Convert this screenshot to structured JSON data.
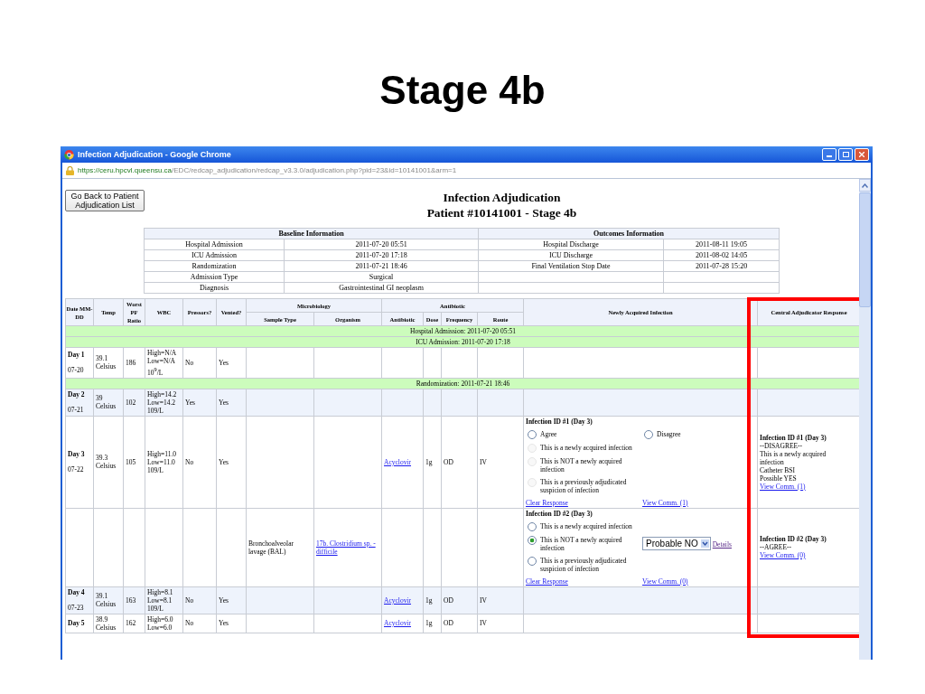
{
  "slide_title": "Stage 4b",
  "window": {
    "title": "Infection Adjudication - Google Chrome",
    "url_host": "https://ceru.hpcvl.queensu.ca",
    "url_path": "/EDC/redcap_adjudication/redcap_v3.3.0/adjudication.php?pid=23&id=10141001&arm=1"
  },
  "back_button": "Go Back to Patient Adjudication List",
  "heading": [
    "Infection Adjudication",
    "Patient #10141001 - Stage 4b"
  ],
  "info_table": {
    "baseline_title": "Baseline Information",
    "outcomes_title": "Outcomes Information",
    "baseline": [
      {
        "label": "Hospital Admission",
        "value": "2011-07-20 05:51"
      },
      {
        "label": "ICU Admission",
        "value": "2011-07-20 17:18"
      },
      {
        "label": "Randomization",
        "value": "2011-07-21 18:46"
      },
      {
        "label": "Admission Type",
        "value": "Surgical"
      },
      {
        "label": "Diagnosis",
        "value": "Gastrointestinal GI neoplasm"
      }
    ],
    "outcomes": [
      {
        "label": "Hospital Discharge",
        "value": "2011-08-11 19:05"
      },
      {
        "label": "ICU Discharge",
        "value": "2011-08-02 14:05"
      },
      {
        "label": "Final Ventilation Stop Date",
        "value": "2011-07-28 15:20"
      }
    ]
  },
  "main_table": {
    "columns": [
      {
        "label": "Date MM-DD"
      },
      {
        "label": "Temp"
      },
      {
        "label": "Worst PF Ratio"
      },
      {
        "label": "WBC"
      },
      {
        "label": "Pressors?"
      },
      {
        "label": "Vented?"
      },
      {
        "label": "Microbiology",
        "children": [
          "Sample Type",
          "Organism"
        ]
      },
      {
        "label": "Antibiotic",
        "children": [
          "Antibiotic",
          "Dose",
          "Frequency",
          "Route"
        ]
      },
      {
        "label": "Newly Acquired Infection"
      },
      {
        "label": "Central Adjudicator Response",
        "highlighted": true
      }
    ],
    "rows": [
      {
        "kind": "band",
        "text": "Hospital Admission: 2011-07-20 05:51"
      },
      {
        "kind": "band",
        "text": "ICU Admission: 2011-07-20 17:18"
      },
      {
        "kind": "day",
        "day": "Day 1",
        "date": "07-20",
        "temp": [
          "39.1",
          "Celsius"
        ],
        "pf": "186",
        "wbc": [
          "High=N/A",
          "Low=N/A",
          "10$^{9}$/L"
        ],
        "pressors": "No",
        "vented": "Yes"
      },
      {
        "kind": "band",
        "text": "Randomization: 2011-07-21 18:46"
      },
      {
        "kind": "day",
        "day": "Day 2",
        "date": "07-21",
        "temp": [
          "39",
          "Celsius"
        ],
        "pf": "102",
        "wbc": [
          "High=14.2",
          "Low=14.2",
          "109/L"
        ],
        "pressors": "Yes",
        "vented": "Yes"
      },
      {
        "kind": "day",
        "day": "Day 3",
        "date": "07-22",
        "temp": [
          "39.3",
          "Celsius"
        ],
        "pf": "105",
        "wbc": [
          "High=11.0",
          "Low=11.0",
          "109/L"
        ],
        "pressors": "No",
        "vented": "Yes",
        "entries": [
          {
            "antibiotic": "Acyclovir",
            "dose": "1g",
            "frequency": "OD",
            "route": "IV",
            "infection": {
              "title": "Infection ID #1 (Day 3)",
              "agreement": [
                {
                  "label": "Agree",
                  "selected": false
                },
                {
                  "label": "Disagree",
                  "selected": false
                }
              ],
              "options": [
                {
                  "label": "This is a newly acquired infection",
                  "selected": false,
                  "disabled": true
                },
                {
                  "label": "This is NOT a newly acquired infection",
                  "selected": false,
                  "disabled": true
                },
                {
                  "label": "This is a previously adjudicated suspicion of infection",
                  "selected": false,
                  "disabled": true
                }
              ],
              "clear_link": "Clear Response",
              "comments_link": "View Comm. (1)"
            },
            "central": {
              "title": "Infection ID #1 (Day 3)",
              "lines": [
                "--DISAGREE--",
                "This is a newly acquired infection",
                "Catheter BSI",
                "Possible YES"
              ],
              "link": "View Comm. (1)"
            }
          },
          {
            "sample_type": "Bronchoalveolar lavage (BAL)",
            "organism": "17b. Clostridium sp. - difficile",
            "infection": {
              "title": "Infection ID #2 (Day 3)",
              "options": [
                {
                  "label": "This is a newly acquired infection",
                  "selected": false,
                  "disabled": false
                },
                {
                  "label": "This is NOT a newly acquired infection",
                  "selected": true,
                  "disabled": false,
                  "dropdown": "Probable NO",
                  "details_link": "Details"
                },
                {
                  "label": "This is a previously adjudicated suspicion of infection",
                  "selected": false,
                  "disabled": false
                }
              ],
              "clear_link": "Clear Response",
              "comments_link": "View Comm. (0)"
            },
            "central": {
              "title": "Infection ID #2 (Day 3)",
              "lines": [
                "--AGREE--"
              ],
              "link": "View Comm. (0)"
            }
          }
        ]
      },
      {
        "kind": "day",
        "day": "Day 4",
        "date": "07-23",
        "temp": [
          "39.1",
          "Celsius"
        ],
        "pf": "163",
        "wbc": [
          "High=8.1",
          "Low=8.1",
          "109/L"
        ],
        "pressors": "No",
        "vented": "Yes",
        "entries": [
          {
            "antibiotic": "Acyclovir",
            "dose": "1g",
            "frequency": "OD",
            "route": "IV"
          }
        ]
      },
      {
        "kind": "day",
        "day": "Day 5",
        "temp": [
          "38.9",
          "Celsius"
        ],
        "pf": "162",
        "wbc": [
          "High=6.0",
          "Low=6.0"
        ],
        "pressors": "No",
        "vented": "Yes",
        "entries": [
          {
            "antibiotic": "Acyclovir",
            "dose": "1g",
            "frequency": "OD",
            "route": "IV"
          }
        ]
      }
    ]
  }
}
